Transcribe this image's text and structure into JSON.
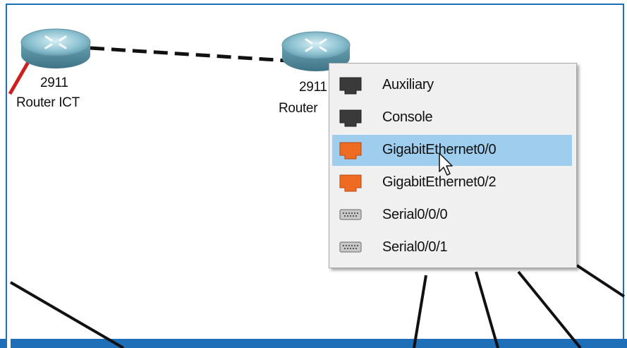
{
  "devices": [
    {
      "model": "2911",
      "name": "Router ICT"
    },
    {
      "model": "2911",
      "name": "Router"
    }
  ],
  "port_menu": {
    "items": [
      {
        "label": "Auxiliary",
        "icon": "rj45-port-dark-icon",
        "selected": false
      },
      {
        "label": "Console",
        "icon": "rj45-port-dark-icon",
        "selected": false
      },
      {
        "label": "GigabitEthernet0/0",
        "icon": "rj45-port-orange-icon",
        "selected": true
      },
      {
        "label": "GigabitEthernet0/2",
        "icon": "rj45-port-orange-icon",
        "selected": false
      },
      {
        "label": "Serial0/0/0",
        "icon": "serial-port-icon",
        "selected": false
      },
      {
        "label": "Serial0/0/1",
        "icon": "serial-port-icon",
        "selected": false
      }
    ]
  },
  "colors": {
    "frame_border": "#1e6fb8",
    "menu_highlight": "#9fcdee",
    "port_orange": "#ef6b21",
    "port_dark": "#3a3a3a"
  }
}
